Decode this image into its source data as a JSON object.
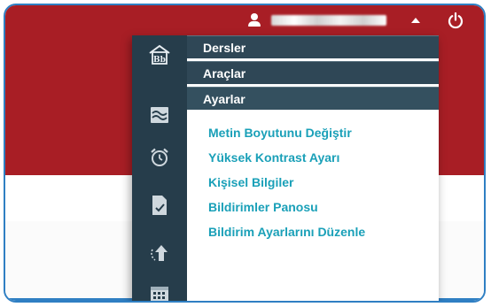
{
  "header": {
    "user_display_name": ""
  },
  "colors": {
    "brand_red": "#a81e25",
    "rail_dark": "#263d4b",
    "menu_head": "#2f4756",
    "link_teal": "#1aa0b8",
    "frame_blue": "#2f7fc3"
  },
  "icons": {
    "user": "user-icon",
    "caret": "caret-up-icon",
    "power": "power-icon",
    "rail": [
      "blackboard-home-icon",
      "wave-grades-icon",
      "alarm-clock-icon",
      "document-check-icon",
      "upload-arrow-icon",
      "calendar-icon"
    ]
  },
  "menu": {
    "sections": [
      {
        "label": "Dersler"
      },
      {
        "label": "Araçlar"
      },
      {
        "label": "Ayarlar"
      }
    ],
    "settings_items": [
      {
        "label": "Metin Boyutunu Değiştir"
      },
      {
        "label": "Yüksek Kontrast Ayarı"
      },
      {
        "label": "Kişisel Bilgiler"
      },
      {
        "label": "Bildirimler Panosu"
      },
      {
        "label": "Bildirim Ayarlarını Düzenle"
      }
    ]
  },
  "branding": {
    "home_logo_text": "Bb"
  }
}
